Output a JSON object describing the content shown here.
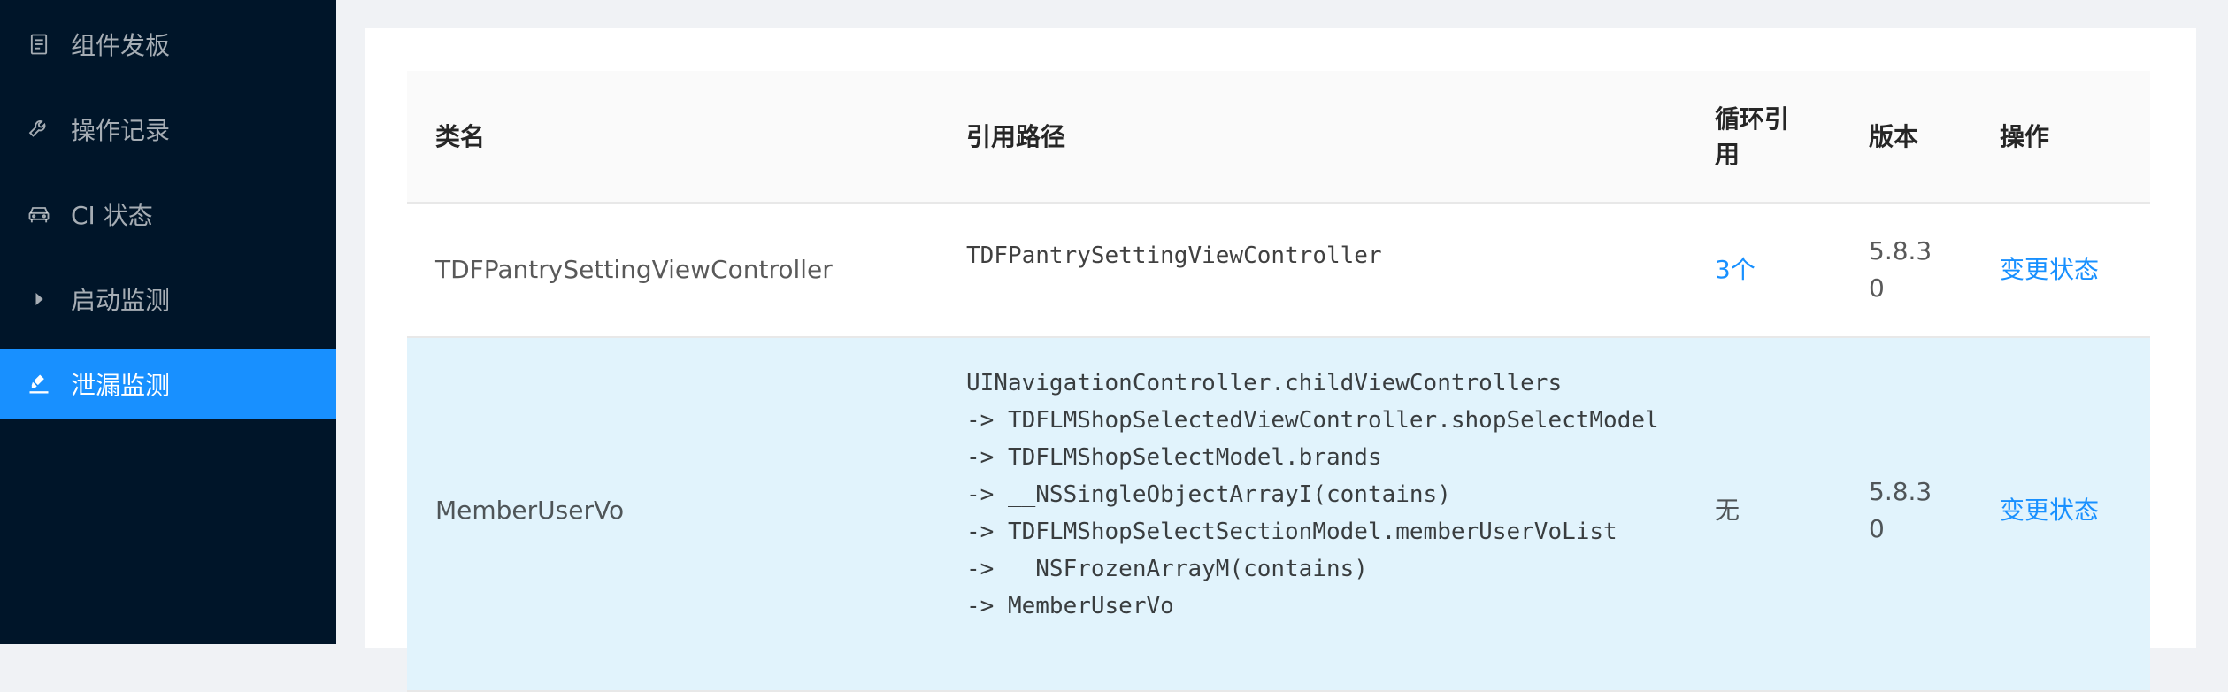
{
  "sidebar": {
    "items": [
      {
        "label": "组件发板",
        "icon": "document-icon",
        "active": false
      },
      {
        "label": "操作记录",
        "icon": "wrench-icon",
        "active": false
      },
      {
        "label": "CI 状态",
        "icon": "car-icon",
        "active": false
      },
      {
        "label": "启动监测",
        "icon": "caret-right-icon",
        "active": false
      },
      {
        "label": "泄漏监测",
        "icon": "highlighter-icon",
        "active": true
      }
    ]
  },
  "table": {
    "headers": {
      "name": "类名",
      "path": "引用路径",
      "cycle_line1": "循环引",
      "cycle_line2": "用",
      "version": "版本",
      "action": "操作"
    },
    "rows": [
      {
        "name": "TDFPantrySettingViewController",
        "path": "TDFPantrySettingViewController",
        "cycle": "3个",
        "version_line1": "5.8.3",
        "version_line2": "0",
        "action": "变更状态"
      },
      {
        "name": "MemberUserVo",
        "path": "UINavigationController.childViewControllers\n-> TDFLMShopSelectedViewController.shopSelectModel\n-> TDFLMShopSelectModel.brands\n-> __NSSingleObjectArrayI(contains)\n-> TDFLMShopSelectSectionModel.memberUserVoList\n-> __NSFrozenArrayM(contains)\n-> MemberUserVo",
        "cycle": "无",
        "version_line1": "5.8.3",
        "version_line2": "0",
        "action": "变更状态"
      }
    ]
  },
  "colors": {
    "sidebar_bg": "#001529",
    "active_bg": "#1890ff",
    "link": "#1890ff",
    "highlight_row": "#e1f3fc"
  }
}
